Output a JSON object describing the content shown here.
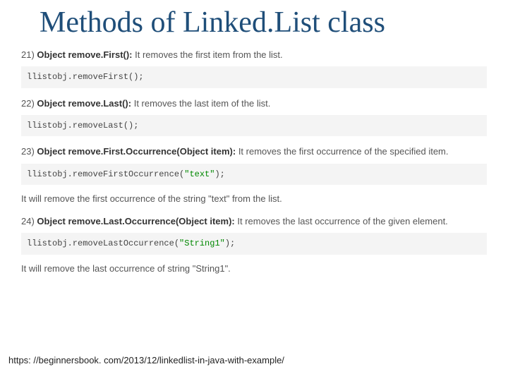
{
  "title": "Methods of Linked.List class",
  "items": [
    {
      "num": "21)",
      "sig": "Object remove.First():",
      "desc": " It removes the first item from the list.",
      "code_prefix": "llistobj.removeFirst();",
      "code_string": "",
      "code_suffix": ""
    },
    {
      "num": "22)",
      "sig": "Object remove.Last():",
      "desc": " It removes the last item of the list.",
      "code_prefix": "llistobj.removeLast();",
      "code_string": "",
      "code_suffix": ""
    },
    {
      "num": "23)",
      "sig": "Object remove.First.Occurrence(Object item):",
      "desc": " It removes the first occurrence of the specified item.",
      "code_prefix": "llistobj.removeFirstOccurrence(",
      "code_string": "\"text\"",
      "code_suffix": ");",
      "note": "It will remove the first occurrence of the string \"text\" from the list."
    },
    {
      "num": "24)",
      "sig": "Object remove.Last.Occurrence(Object item):",
      "desc": " It removes the last occurrence of the given element.",
      "code_prefix": "llistobj.removeLastOccurrence(",
      "code_string": "\"String1\"",
      "code_suffix": ");",
      "note": "It will remove the last occurrence of string \"String1\"."
    }
  ],
  "source": "https: //beginnersbook. com/2013/12/linkedlist-in-java-with-example/"
}
